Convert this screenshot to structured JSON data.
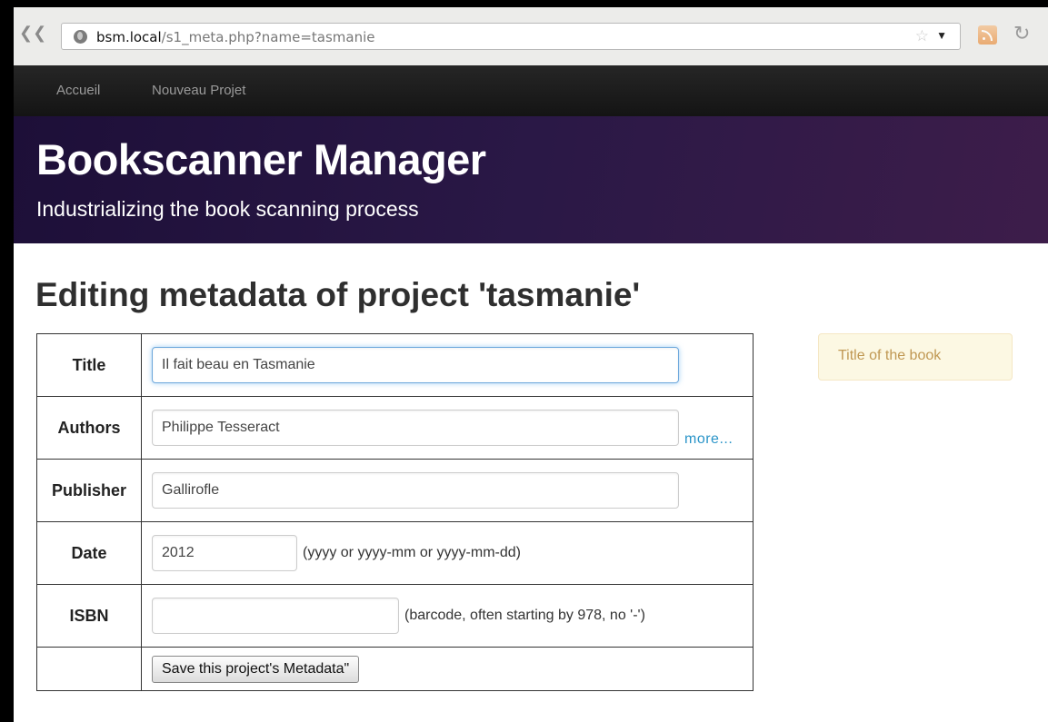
{
  "browser": {
    "url_host": "bsm.local",
    "url_path": "/s1_meta.php?name=tasmanie"
  },
  "nav": {
    "items": [
      {
        "label": "Accueil"
      },
      {
        "label": "Nouveau Projet"
      }
    ]
  },
  "hero": {
    "title": "Bookscanner Manager",
    "subtitle": "Industrializing the book scanning process"
  },
  "main": {
    "heading": "Editing metadata of project 'tasmanie'",
    "form": {
      "title": {
        "label": "Title",
        "value": "Il fait beau en Tasmanie"
      },
      "authors": {
        "label": "Authors",
        "value": "Philippe Tesseract",
        "more_link": "more..."
      },
      "publisher": {
        "label": "Publisher",
        "value": "Gallirofle"
      },
      "date": {
        "label": "Date",
        "value": "2012",
        "hint": "(yyyy or yyyy-mm or yyyy-mm-dd)"
      },
      "isbn": {
        "label": "ISBN",
        "value": "",
        "hint": "(barcode, often starting by 978, no '-')"
      },
      "save_label": "Save this project's Metadata\""
    },
    "help_text": "Title of the book"
  },
  "colors": {
    "navbar": "#1b1b1b",
    "hero_start": "#1d0f38",
    "hero_end": "#3d1d4a",
    "link": "#2a94c8",
    "help_bg": "#fcf8e3",
    "help_text": "#c09853"
  },
  "icons": {
    "back": "back-arrow-icon",
    "site": "globe-icon",
    "bookmark": "star-icon",
    "feed": "rss-icon",
    "reload": "reload-icon"
  }
}
